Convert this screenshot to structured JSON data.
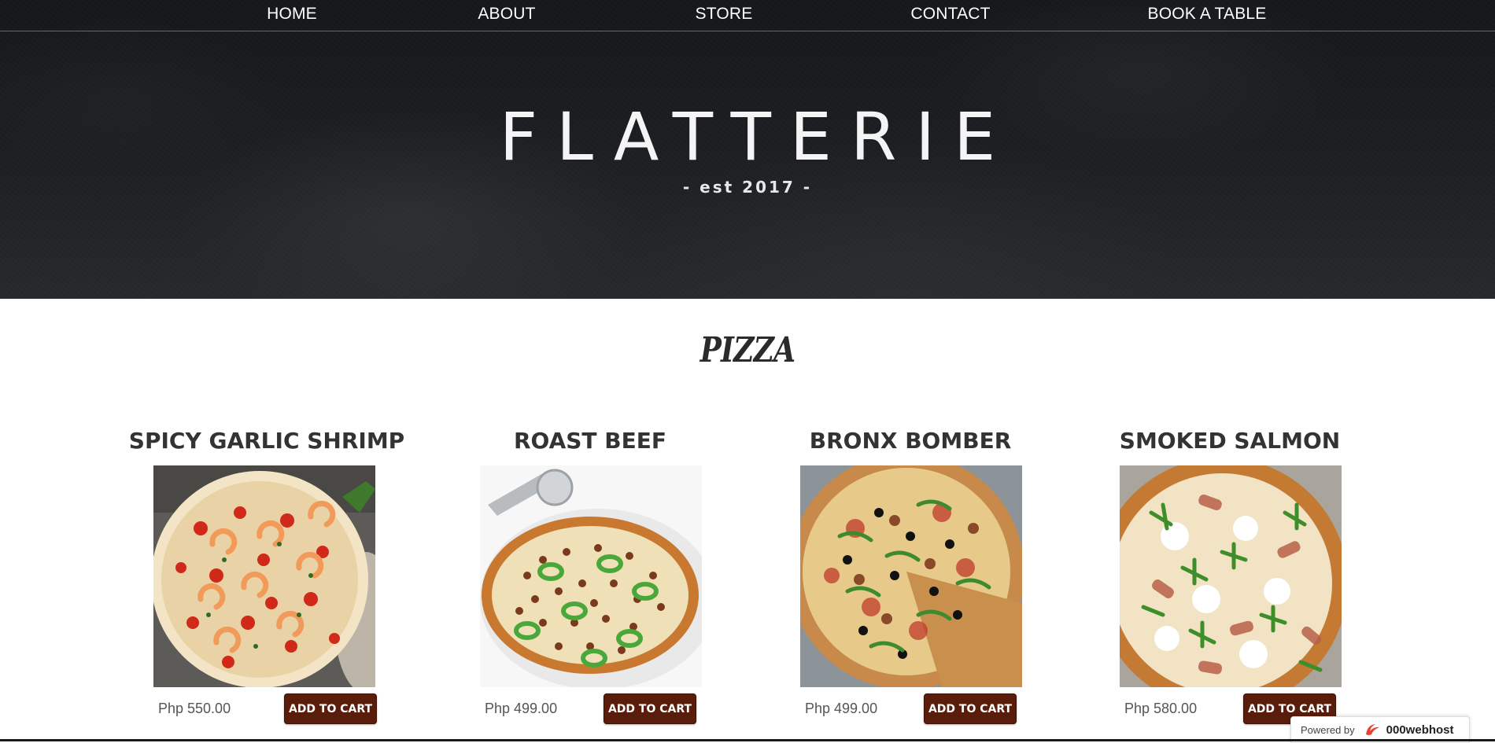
{
  "nav": {
    "items": [
      {
        "label": "HOME"
      },
      {
        "label": "ABOUT"
      },
      {
        "label": "STORE"
      },
      {
        "label": "CONTACT"
      },
      {
        "label": "BOOK A TABLE"
      }
    ]
  },
  "hero": {
    "logo": "FLATTERIE",
    "tagline": "- est 2017 -"
  },
  "section": {
    "title": "PIZZA"
  },
  "products": [
    {
      "name": "SPICY GARLIC SHRIMP",
      "price": "Php 550.00",
      "button": "ADD TO CART",
      "image_icon": "shrimp-pizza-image"
    },
    {
      "name": "ROAST BEEF",
      "price": "Php 499.00",
      "button": "ADD TO CART",
      "image_icon": "roast-beef-pizza-image"
    },
    {
      "name": "BRONX BOMBER",
      "price": "Php 499.00",
      "button": "ADD TO CART",
      "image_icon": "bronx-bomber-pizza-image"
    },
    {
      "name": "SMOKED SALMON",
      "price": "Php 580.00",
      "button": "ADD TO CART",
      "image_icon": "smoked-salmon-pizza-image"
    }
  ],
  "footer_badge": {
    "label": "Powered by",
    "brand": "000webhost"
  },
  "colors": {
    "hero_bg": "#1d2023",
    "button_bg": "#5a1d0b",
    "text_dark": "#333333"
  }
}
